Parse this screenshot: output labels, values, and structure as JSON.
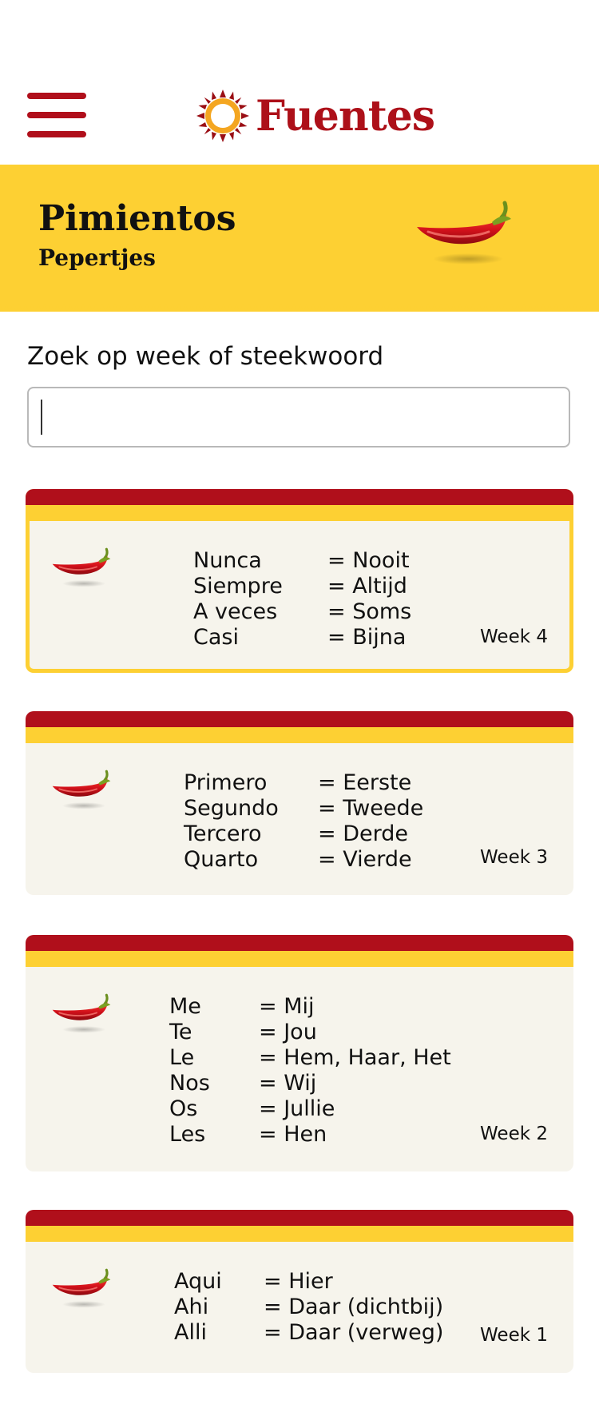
{
  "header": {
    "logo_text": "Fuentes",
    "menu_icon": "hamburger-icon",
    "logo_icon": "sun-icon",
    "brand_color": "#ad1019"
  },
  "hero": {
    "title": "Pimientos",
    "subtitle": "Pepertjes",
    "icon": "chili-pepper-icon",
    "background": "#fdd033"
  },
  "search": {
    "label": "Zoek op week of steekwoord",
    "value": "",
    "placeholder": ""
  },
  "cards": [
    {
      "week": "Week 4",
      "selected": true,
      "pairs": [
        {
          "es": "Nunca",
          "nl": "= Nooit"
        },
        {
          "es": "Siempre",
          "nl": "= Altijd"
        },
        {
          "es": "A veces",
          "nl": "= Soms"
        },
        {
          "es": "Casi",
          "nl": "= Bijna"
        }
      ]
    },
    {
      "week": "Week 3",
      "selected": false,
      "pairs": [
        {
          "es": "Primero",
          "nl": "= Eerste"
        },
        {
          "es": "Segundo",
          "nl": "= Tweede"
        },
        {
          "es": "Tercero",
          "nl": "= Derde"
        },
        {
          "es": "Quarto",
          "nl": "= Vierde"
        }
      ]
    },
    {
      "week": "Week 2",
      "selected": false,
      "pairs": [
        {
          "es": "Me",
          "nl": "= Mij"
        },
        {
          "es": "Te",
          "nl": "= Jou"
        },
        {
          "es": "Le",
          "nl": "= Hem, Haar, Het"
        },
        {
          "es": "Nos",
          "nl": "= Wij"
        },
        {
          "es": "Os",
          "nl": "= Jullie"
        },
        {
          "es": "Les",
          "nl": "= Hen"
        }
      ]
    },
    {
      "week": "Week 1",
      "selected": false,
      "pairs": [
        {
          "es": "Aqui",
          "nl": "= Hier"
        },
        {
          "es": "Ahi",
          "nl": "= Daar (dichtbij)"
        },
        {
          "es": "Alli",
          "nl": "= Daar (verweg)"
        }
      ]
    }
  ]
}
